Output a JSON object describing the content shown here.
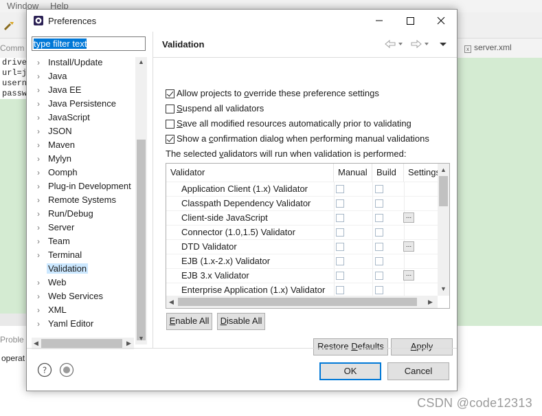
{
  "ide": {
    "menu_window": "Window",
    "menu_help": "Help",
    "tab_left": "Comm",
    "tab_right": "server.xml",
    "editor_lines": [
      "drive",
      "url=j",
      "usern",
      "passw"
    ],
    "problems": "Proble",
    "console": "operat",
    "watermark": "CSDN @code12313"
  },
  "dialog": {
    "title": "Preferences",
    "filter_value": "type filter text",
    "tree": [
      {
        "label": "Install/Update",
        "expandable": true
      },
      {
        "label": "Java",
        "expandable": true
      },
      {
        "label": "Java EE",
        "expandable": true
      },
      {
        "label": "Java Persistence",
        "expandable": true
      },
      {
        "label": "JavaScript",
        "expandable": true
      },
      {
        "label": "JSON",
        "expandable": true
      },
      {
        "label": "Maven",
        "expandable": true
      },
      {
        "label": "Mylyn",
        "expandable": true
      },
      {
        "label": "Oomph",
        "expandable": true
      },
      {
        "label": "Plug-in Development",
        "expandable": true
      },
      {
        "label": "Remote Systems",
        "expandable": true
      },
      {
        "label": "Run/Debug",
        "expandable": true
      },
      {
        "label": "Server",
        "expandable": true
      },
      {
        "label": "Team",
        "expandable": true
      },
      {
        "label": "Terminal",
        "expandable": true
      },
      {
        "label": "Validation",
        "expandable": false,
        "selected": true
      },
      {
        "label": "Web",
        "expandable": true
      },
      {
        "label": "Web Services",
        "expandable": true
      },
      {
        "label": "XML",
        "expandable": true
      },
      {
        "label": "Yaml Editor",
        "expandable": true
      }
    ],
    "page_title": "Validation",
    "options": [
      {
        "pre": "Allow projects to ",
        "mn": "o",
        "post": "verride these preference settings",
        "checked": true
      },
      {
        "pre": "",
        "mn": "S",
        "post": "uspend all validators",
        "checked": false
      },
      {
        "pre": "",
        "mn": "S",
        "post": "ave all modified resources automatically prior to validating",
        "checked": false
      },
      {
        "pre": "Show a ",
        "mn": "c",
        "post": "onfirmation dialog when performing manual validations",
        "checked": true
      }
    ],
    "intro": {
      "pre": "The selected ",
      "mn": "v",
      "post": "alidators will run when validation is performed:"
    },
    "columns": [
      "Validator",
      "Manual",
      "Build",
      "Settings"
    ],
    "validators": [
      {
        "name": "Application Client (1.x) Validator",
        "settings": false
      },
      {
        "name": "Classpath Dependency Validator",
        "settings": false
      },
      {
        "name": "Client-side JavaScript",
        "settings": true
      },
      {
        "name": "Connector (1.0,1.5) Validator",
        "settings": false
      },
      {
        "name": "DTD Validator",
        "settings": true
      },
      {
        "name": "EJB (1.x-2.x) Validator",
        "settings": false
      },
      {
        "name": "EJB 3.x Validator",
        "settings": true
      },
      {
        "name": "Enterprise Application (1.x) Validator",
        "settings": false
      }
    ],
    "settings_button": "...",
    "enable_all": {
      "mn": "E",
      "post": "nable All"
    },
    "disable_all": {
      "mn": "D",
      "post": "isable All"
    },
    "restore_defaults": {
      "pre": "Restore ",
      "mn": "D",
      "post": "efaults"
    },
    "apply": {
      "mn": "A",
      "post": "pply"
    },
    "ok": "OK",
    "cancel": "Cancel"
  }
}
